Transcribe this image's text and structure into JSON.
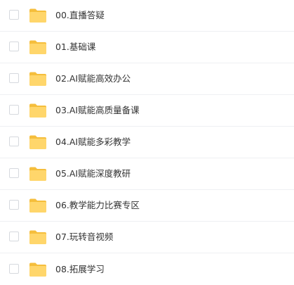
{
  "folders": [
    {
      "label": "00.直播答疑"
    },
    {
      "label": "01.基础课"
    },
    {
      "label": "02.AI赋能高效办公"
    },
    {
      "label": "03.AI赋能高质量备课"
    },
    {
      "label": "04.AI赋能多彩教学"
    },
    {
      "label": "05.AI赋能深度教研"
    },
    {
      "label": "06.教学能力比赛专区"
    },
    {
      "label": "07.玩转音视频"
    },
    {
      "label": "08.拓展学习"
    }
  ],
  "icon": "folder-icon",
  "colors": {
    "folder_back": "#F5BE3C",
    "folder_front": "#FFD66B",
    "checkbox_border": "#D6D9DE",
    "divider": "#EEF0F3",
    "text": "#333333"
  }
}
